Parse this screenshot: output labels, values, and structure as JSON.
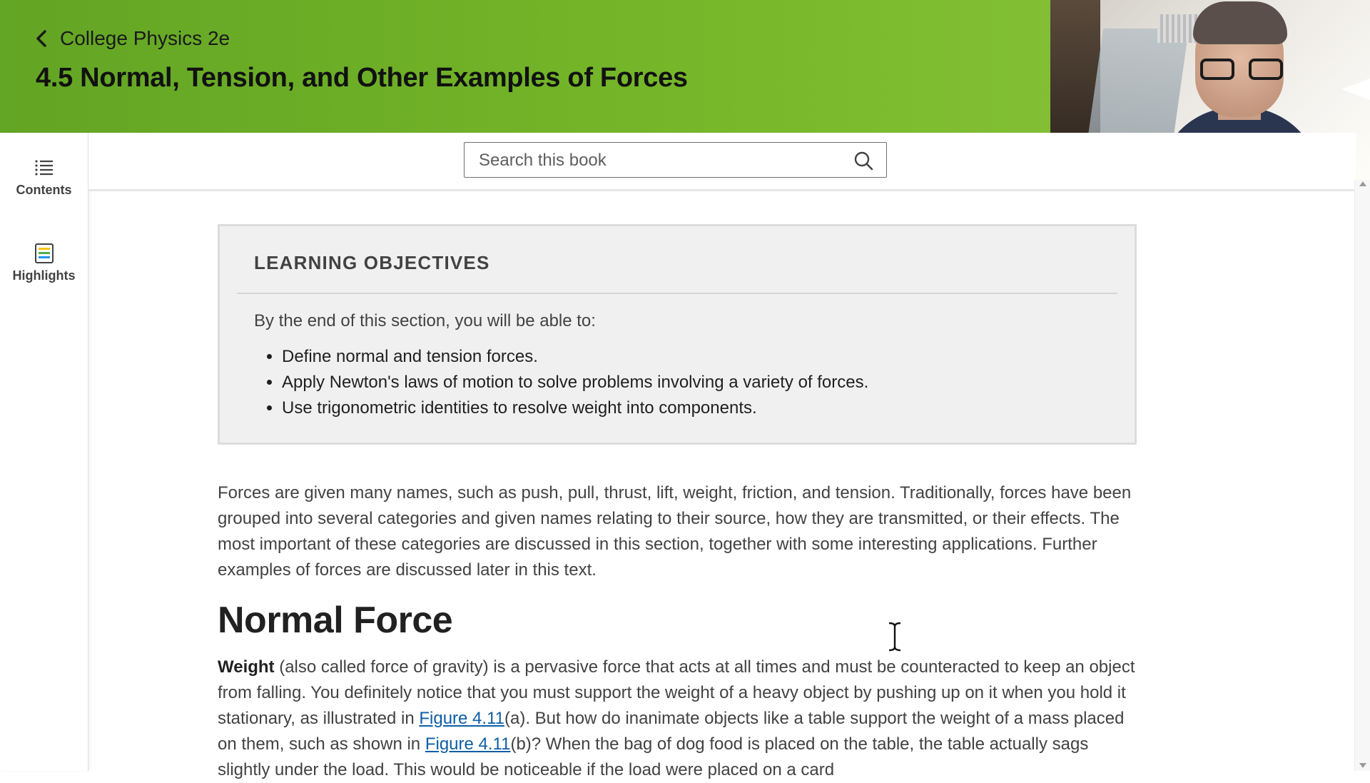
{
  "header": {
    "back_label": "College Physics 2e",
    "title": "4.5 Normal, Tension, and Other Examples of Forces",
    "colors": {
      "gradient_start": "#63a524",
      "gradient_end": "#8dc63f"
    }
  },
  "sidebar": {
    "items": [
      {
        "label": "Contents",
        "icon": "list-icon"
      },
      {
        "label": "Highlights",
        "icon": "highlights-icon"
      }
    ]
  },
  "search": {
    "placeholder": "Search this book",
    "value": "",
    "icon": "search-icon"
  },
  "objectives": {
    "heading": "LEARNING OBJECTIVES",
    "intro": "By the end of this section, you will be able to:",
    "items": [
      "Define normal and tension forces.",
      "Apply Newton's laws of motion to solve problems involving a variety of forces.",
      "Use trigonometric identities to resolve weight into components."
    ]
  },
  "body": {
    "intro_paragraph": "Forces are given many names, such as push, pull, thrust, lift, weight, friction, and tension. Traditionally, forces have been grouped into several categories and given names relating to their source, how they are transmitted, or their effects. The most important of these categories are discussed in this section, together with some interesting applications. Further examples of forces are discussed later in this text.",
    "section_heading": "Normal Force",
    "weight_term": "Weight",
    "p2_part1": " (also called force of gravity) is a pervasive force that acts at all times and must be counteracted to keep an object from falling. You definitely notice that you must support the weight of a heavy object by pushing up on it when you hold it stationary, as illustrated in ",
    "fig_link_1": "Figure 4.11",
    "p2_part2": "(a). But how do inanimate objects like a table support the weight of a mass placed on them, such as shown in ",
    "fig_link_2": "Figure 4.11",
    "p2_part3": "(b)? When the bag of dog food is placed on the table, the table actually sags slightly under the load. This would be noticeable if the load were placed on a card"
  }
}
